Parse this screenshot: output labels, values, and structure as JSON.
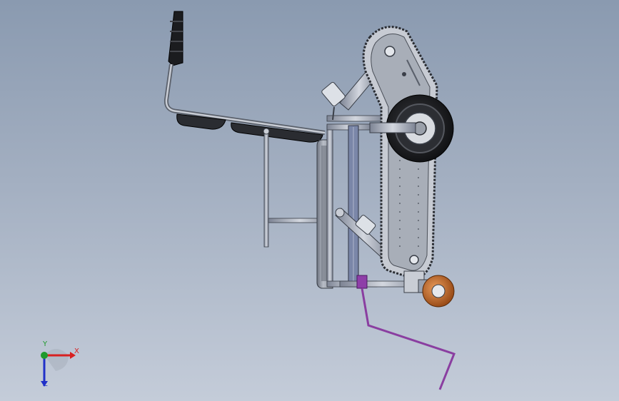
{
  "triad": {
    "x_label": "X",
    "y_label": "Y",
    "z_label": "Z",
    "colors": {
      "x": "#d82020",
      "y": "#1f9a2c",
      "z": "#2030c8"
    }
  },
  "colors": {
    "background_top": "#8a9ab0",
    "background_bottom": "#c4ccd9",
    "frame": "#9aa2b0",
    "outline": "#3a3f48",
    "track": "#a8aeb8",
    "tire": "#1e1f22",
    "hub": "#d8dbe0",
    "caster": "#c26a2a",
    "mast": "#7a86a8",
    "wire": "#8a3ea0"
  }
}
